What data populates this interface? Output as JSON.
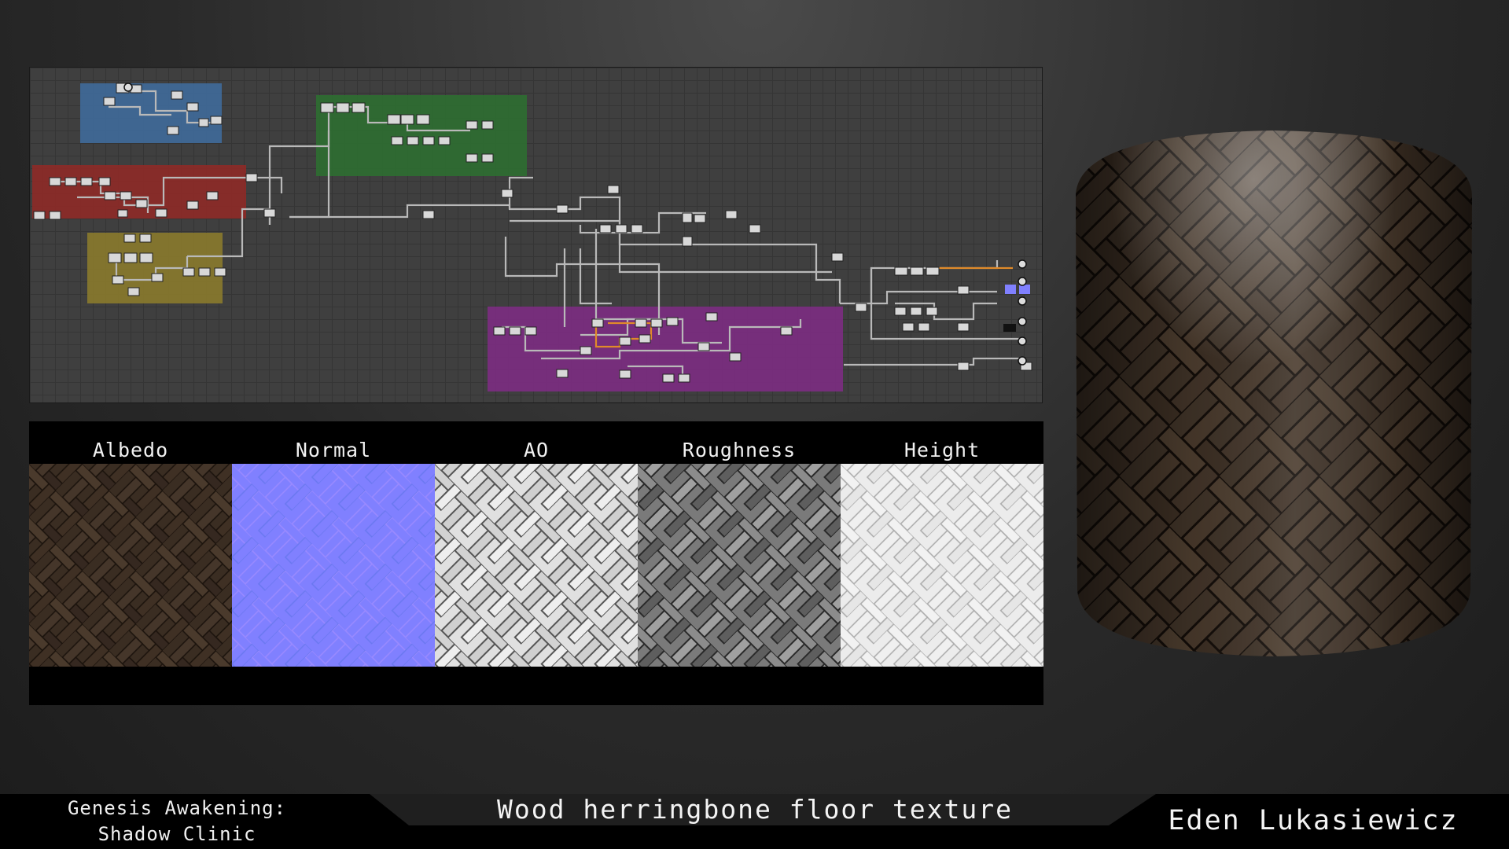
{
  "maps": {
    "labels": [
      "Albedo",
      "Normal",
      "AO",
      "Roughness",
      "Height"
    ]
  },
  "footer": {
    "project_line1": "Genesis Awakening:",
    "project_line2": "Shadow Clinic",
    "title": "Wood herringbone floor texture",
    "artist": "Eden Lukasiewicz"
  },
  "colors": {
    "frame_blue": "#3f6a9a",
    "frame_red": "#8e2a27",
    "frame_yellow": "#8a7a2c",
    "frame_green": "#2d6e31",
    "frame_purple": "#7c2c82",
    "normal_map": "#8080ff",
    "wire": "#b9b9b9",
    "wire_orange": "#e08a2a",
    "wood_dark": "#3a2d22"
  },
  "icons": [
    "output-node-icon"
  ]
}
